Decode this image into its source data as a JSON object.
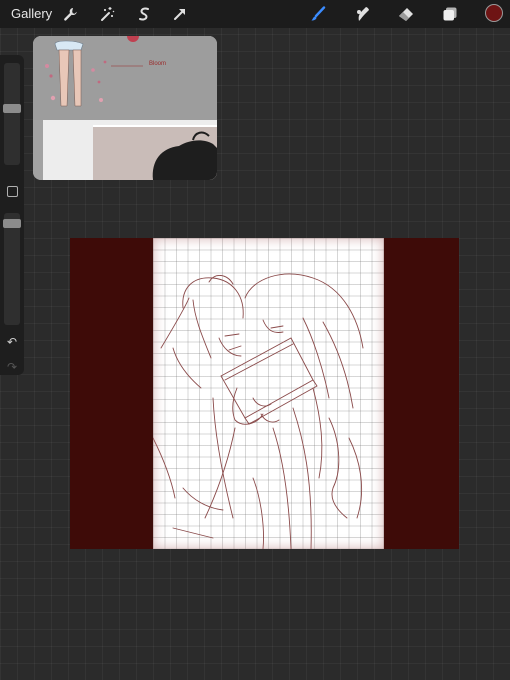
{
  "toolbar": {
    "gallery_label": "Gallery",
    "icons": [
      "wrench-icon",
      "magic-wand-icon",
      "selection-icon",
      "transform-arrow-icon",
      "brush-icon",
      "smudge-icon",
      "eraser-icon",
      "layers-icon"
    ],
    "active_tool": "brush",
    "accent": "#3b8cff",
    "current_color": "#6e1414"
  },
  "reference": {
    "handwritten_label": "Bloom"
  },
  "canvas": {
    "background_color": "#3e0b08",
    "paper_color": "#ffffff",
    "sketch_color": "#8a4a4a"
  }
}
